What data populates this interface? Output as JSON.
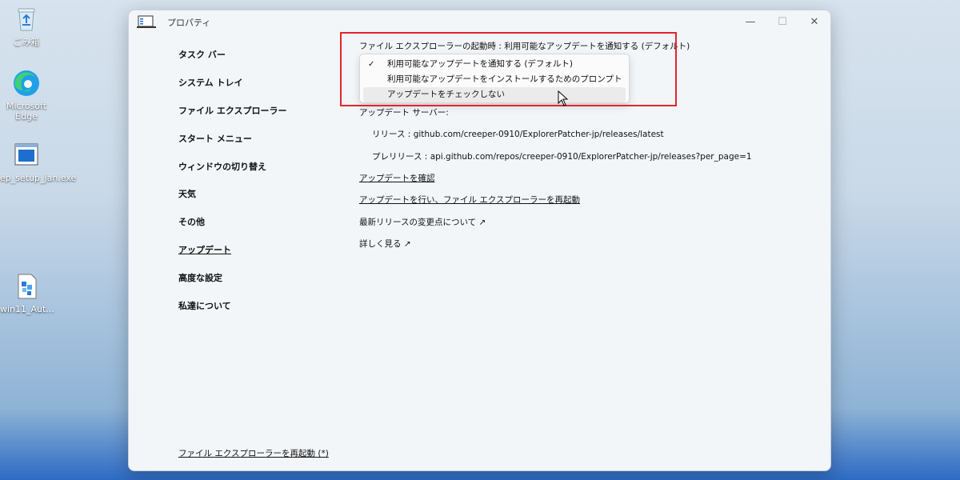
{
  "desktop": {
    "icons": [
      {
        "label": "ごみ箱"
      },
      {
        "label": "Microsoft Edge"
      },
      {
        "label": "ep_setup_jan.exe"
      },
      {
        "label": "win11_Aut..."
      }
    ]
  },
  "window": {
    "title": "プロパティ",
    "controls": {
      "minimize": "—",
      "maximize": "☐",
      "close": "✕"
    }
  },
  "sidebar": {
    "items": [
      {
        "label": "タスク バー"
      },
      {
        "label": "システム トレイ"
      },
      {
        "label": "ファイル エクスプローラー"
      },
      {
        "label": "スタート メニュー"
      },
      {
        "label": "ウィンドウの切り替え"
      },
      {
        "label": "天気"
      },
      {
        "label": "その他"
      },
      {
        "label": "アップデート"
      },
      {
        "label": "高度な設定"
      },
      {
        "label": "私達について"
      }
    ],
    "active_index": 7,
    "restart_link": "ファイル エクスプローラーを再起動 (*)"
  },
  "content": {
    "setting_label": "ファイル エクスプローラーの起動時 : 利用可能なアップデートを通知する (デフォルト)",
    "dropdown": {
      "options": [
        {
          "label": "利用可能なアップデートを通知する (デフォルト)",
          "checked": true
        },
        {
          "label": "利用可能なアップデートをインストールするためのプロンプトを表示",
          "checked": false
        },
        {
          "label": "アップデートをチェックしない",
          "checked": false
        }
      ],
      "check_glyph": "✓"
    },
    "update_server_label": "アップデート サーバー:",
    "release_line": "リリース : github.com/creeper-0910/ExplorerPatcher-jp/releases/latest",
    "prerelease_line": "プレリリース : api.github.com/repos/creeper-0910/ExplorerPatcher-jp/releases?per_page=1",
    "check_updates_link": "アップデートを確認",
    "update_restart_link": "アップデートを行い、ファイル エクスプローラーを再起動",
    "changelog_link": "最新リリースの変更点について ↗",
    "learn_more_link": "詳しく見る ↗"
  },
  "colors": {
    "highlight": "#e0262b",
    "window_bg": "#f3f6f9"
  }
}
